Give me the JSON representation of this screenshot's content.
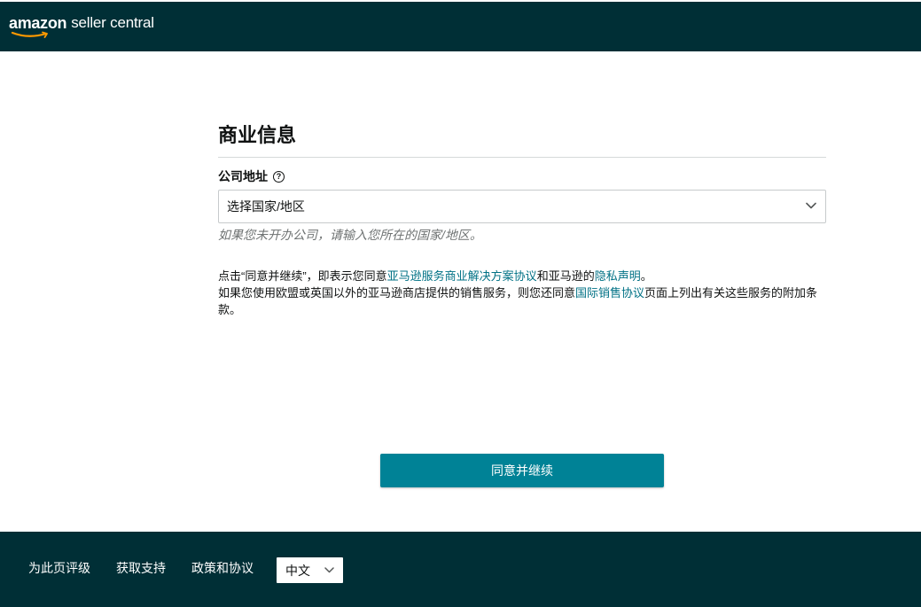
{
  "header": {
    "logo_brand": "amazon",
    "logo_product": "seller central",
    "background": "#002f36"
  },
  "form": {
    "title": "商业信息",
    "address_label": "公司地址",
    "help_icon": "question-circle-icon",
    "country_select": {
      "value": "选择国家/地区"
    },
    "hint": "如果您未开办公司，请输入您所在的国家/地区。"
  },
  "terms": {
    "line1_prefix": "点击“同意并继续”，即表示您同意",
    "link_bsa": "亚马逊服务商业解决方案协议",
    "line1_mid": "和亚马逊的",
    "link_privacy": "隐私声明",
    "line1_suffix": "。",
    "line2_prefix": "如果您使用欧盟或英国以外的亚马逊商店提供的销售服务，则您还同意",
    "link_intl": "国际销售协议",
    "line2_suffix": "页面上列出有关这些服务的附加条款。"
  },
  "actions": {
    "agree_label": "同意并继续",
    "accent": "#008296"
  },
  "footer": {
    "rate_page": "为此页评级",
    "get_support": "获取支持",
    "policies": "政策和协议",
    "language": "中文",
    "background": "#002f36"
  }
}
